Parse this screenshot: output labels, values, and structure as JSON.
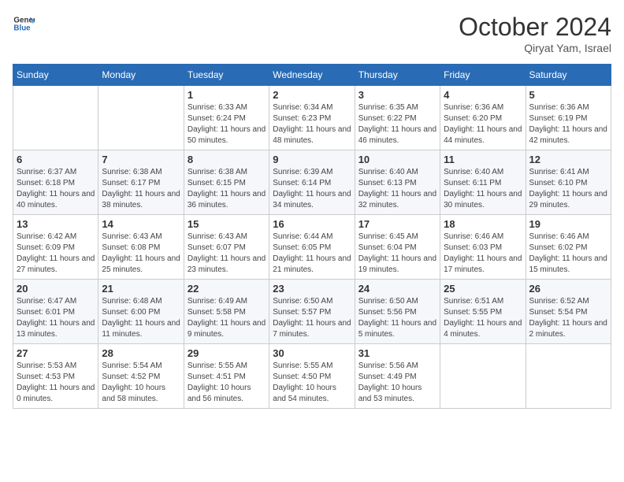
{
  "header": {
    "logo_text_general": "General",
    "logo_text_blue": "Blue",
    "month_title": "October 2024",
    "location": "Qiryat Yam, Israel"
  },
  "days_of_week": [
    "Sunday",
    "Monday",
    "Tuesday",
    "Wednesday",
    "Thursday",
    "Friday",
    "Saturday"
  ],
  "weeks": [
    [
      {
        "day": "",
        "info": ""
      },
      {
        "day": "",
        "info": ""
      },
      {
        "day": "1",
        "info": "Sunrise: 6:33 AM\nSunset: 6:24 PM\nDaylight: 11 hours and 50 minutes."
      },
      {
        "day": "2",
        "info": "Sunrise: 6:34 AM\nSunset: 6:23 PM\nDaylight: 11 hours and 48 minutes."
      },
      {
        "day": "3",
        "info": "Sunrise: 6:35 AM\nSunset: 6:22 PM\nDaylight: 11 hours and 46 minutes."
      },
      {
        "day": "4",
        "info": "Sunrise: 6:36 AM\nSunset: 6:20 PM\nDaylight: 11 hours and 44 minutes."
      },
      {
        "day": "5",
        "info": "Sunrise: 6:36 AM\nSunset: 6:19 PM\nDaylight: 11 hours and 42 minutes."
      }
    ],
    [
      {
        "day": "6",
        "info": "Sunrise: 6:37 AM\nSunset: 6:18 PM\nDaylight: 11 hours and 40 minutes."
      },
      {
        "day": "7",
        "info": "Sunrise: 6:38 AM\nSunset: 6:17 PM\nDaylight: 11 hours and 38 minutes."
      },
      {
        "day": "8",
        "info": "Sunrise: 6:38 AM\nSunset: 6:15 PM\nDaylight: 11 hours and 36 minutes."
      },
      {
        "day": "9",
        "info": "Sunrise: 6:39 AM\nSunset: 6:14 PM\nDaylight: 11 hours and 34 minutes."
      },
      {
        "day": "10",
        "info": "Sunrise: 6:40 AM\nSunset: 6:13 PM\nDaylight: 11 hours and 32 minutes."
      },
      {
        "day": "11",
        "info": "Sunrise: 6:40 AM\nSunset: 6:11 PM\nDaylight: 11 hours and 30 minutes."
      },
      {
        "day": "12",
        "info": "Sunrise: 6:41 AM\nSunset: 6:10 PM\nDaylight: 11 hours and 29 minutes."
      }
    ],
    [
      {
        "day": "13",
        "info": "Sunrise: 6:42 AM\nSunset: 6:09 PM\nDaylight: 11 hours and 27 minutes."
      },
      {
        "day": "14",
        "info": "Sunrise: 6:43 AM\nSunset: 6:08 PM\nDaylight: 11 hours and 25 minutes."
      },
      {
        "day": "15",
        "info": "Sunrise: 6:43 AM\nSunset: 6:07 PM\nDaylight: 11 hours and 23 minutes."
      },
      {
        "day": "16",
        "info": "Sunrise: 6:44 AM\nSunset: 6:05 PM\nDaylight: 11 hours and 21 minutes."
      },
      {
        "day": "17",
        "info": "Sunrise: 6:45 AM\nSunset: 6:04 PM\nDaylight: 11 hours and 19 minutes."
      },
      {
        "day": "18",
        "info": "Sunrise: 6:46 AM\nSunset: 6:03 PM\nDaylight: 11 hours and 17 minutes."
      },
      {
        "day": "19",
        "info": "Sunrise: 6:46 AM\nSunset: 6:02 PM\nDaylight: 11 hours and 15 minutes."
      }
    ],
    [
      {
        "day": "20",
        "info": "Sunrise: 6:47 AM\nSunset: 6:01 PM\nDaylight: 11 hours and 13 minutes."
      },
      {
        "day": "21",
        "info": "Sunrise: 6:48 AM\nSunset: 6:00 PM\nDaylight: 11 hours and 11 minutes."
      },
      {
        "day": "22",
        "info": "Sunrise: 6:49 AM\nSunset: 5:58 PM\nDaylight: 11 hours and 9 minutes."
      },
      {
        "day": "23",
        "info": "Sunrise: 6:50 AM\nSunset: 5:57 PM\nDaylight: 11 hours and 7 minutes."
      },
      {
        "day": "24",
        "info": "Sunrise: 6:50 AM\nSunset: 5:56 PM\nDaylight: 11 hours and 5 minutes."
      },
      {
        "day": "25",
        "info": "Sunrise: 6:51 AM\nSunset: 5:55 PM\nDaylight: 11 hours and 4 minutes."
      },
      {
        "day": "26",
        "info": "Sunrise: 6:52 AM\nSunset: 5:54 PM\nDaylight: 11 hours and 2 minutes."
      }
    ],
    [
      {
        "day": "27",
        "info": "Sunrise: 5:53 AM\nSunset: 4:53 PM\nDaylight: 11 hours and 0 minutes."
      },
      {
        "day": "28",
        "info": "Sunrise: 5:54 AM\nSunset: 4:52 PM\nDaylight: 10 hours and 58 minutes."
      },
      {
        "day": "29",
        "info": "Sunrise: 5:55 AM\nSunset: 4:51 PM\nDaylight: 10 hours and 56 minutes."
      },
      {
        "day": "30",
        "info": "Sunrise: 5:55 AM\nSunset: 4:50 PM\nDaylight: 10 hours and 54 minutes."
      },
      {
        "day": "31",
        "info": "Sunrise: 5:56 AM\nSunset: 4:49 PM\nDaylight: 10 hours and 53 minutes."
      },
      {
        "day": "",
        "info": ""
      },
      {
        "day": "",
        "info": ""
      }
    ]
  ]
}
